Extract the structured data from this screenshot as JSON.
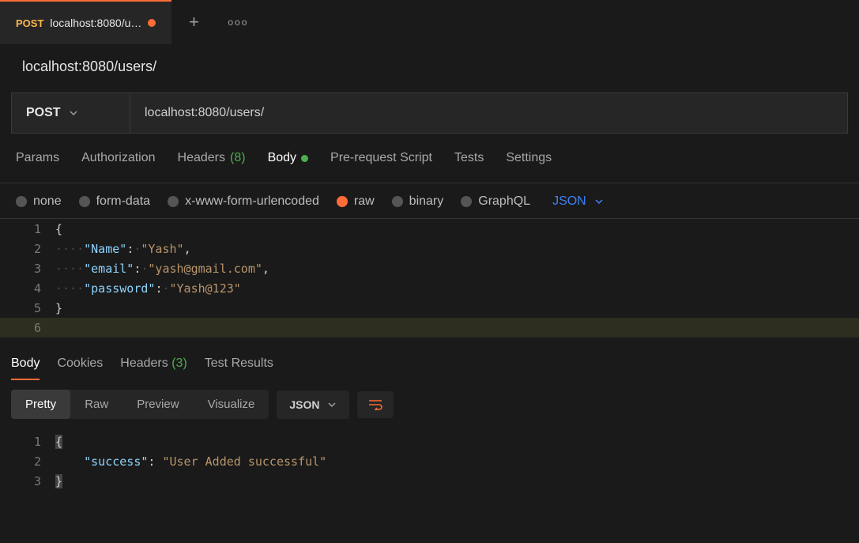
{
  "tab": {
    "method": "POST",
    "title": "localhost:8080/u…",
    "unsaved": true
  },
  "request": {
    "title": "localhost:8080/users/",
    "method": "POST",
    "url": "localhost:8080/users/"
  },
  "req_tabs": {
    "params": "Params",
    "auth": "Authorization",
    "headers_label": "Headers",
    "headers_count": "(8)",
    "body": "Body",
    "prescript": "Pre-request Script",
    "tests": "Tests",
    "settings": "Settings"
  },
  "body_types": {
    "none": "none",
    "formdata": "form-data",
    "xwww": "x-www-form-urlencoded",
    "raw": "raw",
    "binary": "binary",
    "graphql": "GraphQL",
    "content_type": "JSON"
  },
  "request_body": {
    "line1": "{",
    "key_name": "\"Name\"",
    "val_name": "\"Yash\"",
    "key_email": "\"email\"",
    "val_email": "\"yash@gmail.com\"",
    "key_password": "\"password\"",
    "val_password": "\"Yash@123\"",
    "line5": "}"
  },
  "resp_tabs": {
    "body": "Body",
    "cookies": "Cookies",
    "headers_label": "Headers",
    "headers_count": "(3)",
    "tests": "Test Results"
  },
  "view_modes": {
    "pretty": "Pretty",
    "raw": "Raw",
    "preview": "Preview",
    "visualize": "Visualize",
    "format": "JSON"
  },
  "response_body": {
    "open": "{",
    "key_success": "\"success\"",
    "val_success": "\"User Added successful\"",
    "close": "}"
  },
  "line_numbers": {
    "l1": "1",
    "l2": "2",
    "l3": "3",
    "l4": "4",
    "l5": "5",
    "l6": "6",
    "r1": "1",
    "r2": "2",
    "r3": "3"
  }
}
